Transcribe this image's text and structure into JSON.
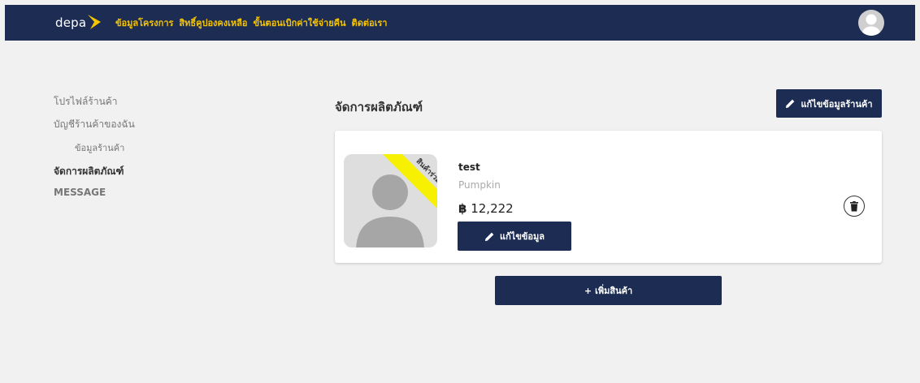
{
  "navbar": {
    "logo_text": "depa",
    "links": [
      "ข้อมูลโครงการ",
      "สิทธิ์คูปองคงเหลือ",
      "ขั้นตอนเบิกค่าใช้จ่ายคืน",
      "ติดต่อเรา"
    ],
    "avatar_icon": "user-avatar-icon",
    "background": "#1c2c52",
    "link_color": "#f5c400"
  },
  "sidebar": {
    "items": [
      "โปรไฟล์ร้านค้า",
      "บัญชีร้านค้าของฉัน",
      "ข้อมูลร้านค้า",
      "จัดการผลิตภัณฑ์",
      "MESSAGE"
    ],
    "active": "จัดการผลิตภัณฑ์"
  },
  "main": {
    "title": "จัดการผลิตภัณฑ์",
    "edit_shop_label": "แก้ไขข้อมูลร้านค้า",
    "add_product_label": "เพิ่มสินค้า",
    "add_prefix": "+"
  },
  "product": {
    "name": "test",
    "shop": "Pumpkin",
    "currency": "฿",
    "price": "12,222",
    "ribbon": "สินค้าร่วมโครงการ",
    "ribbon_color": "#f7f000",
    "edit_label": "แก้ไขข้อมูล",
    "delete_icon": "trash-icon"
  }
}
